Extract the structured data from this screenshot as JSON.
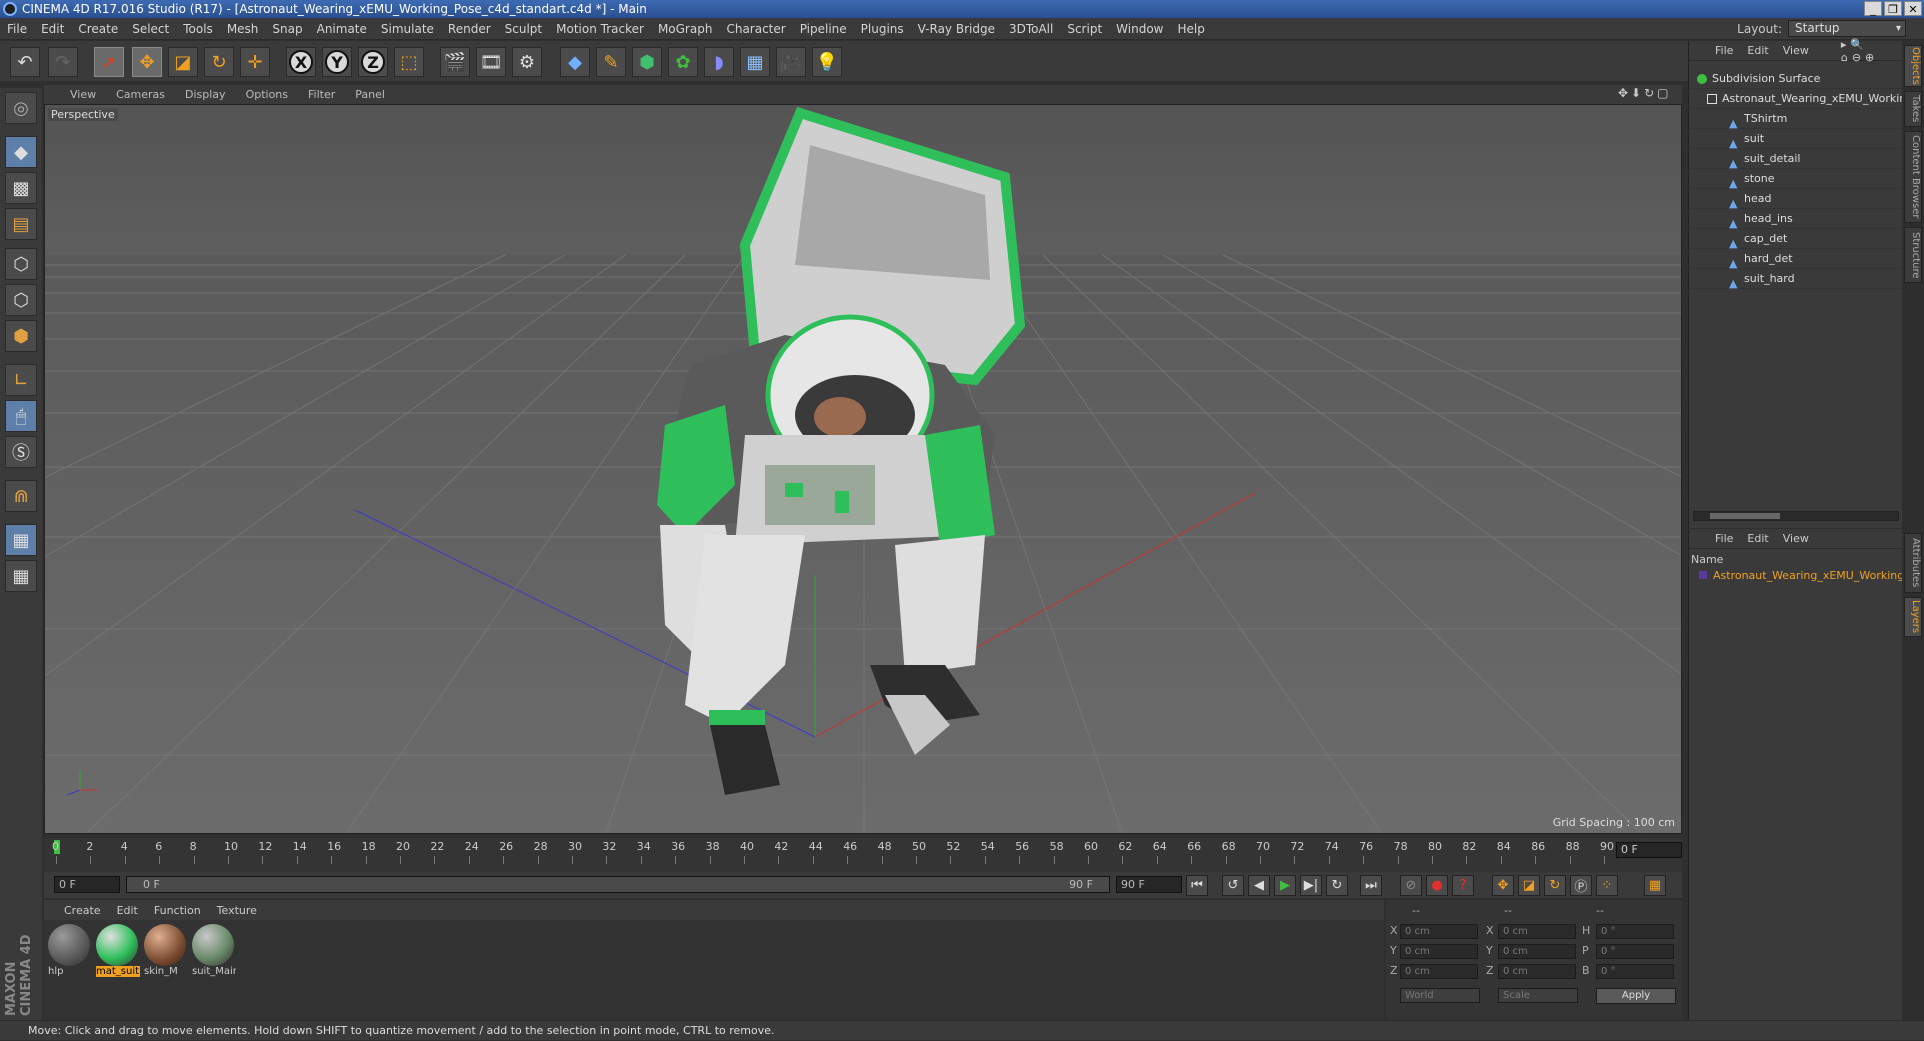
{
  "window": {
    "title": "CINEMA 4D R17.016 Studio (R17) - [Astronaut_Wearing_xEMU_Working_Pose_c4d_standart.c4d *] - Main"
  },
  "menu": [
    "File",
    "Edit",
    "Create",
    "Select",
    "Tools",
    "Mesh",
    "Snap",
    "Animate",
    "Simulate",
    "Render",
    "Sculpt",
    "Motion Tracker",
    "MoGraph",
    "Character",
    "Pipeline",
    "Plugins",
    "V-Ray Bridge",
    "3DToAll",
    "Script",
    "Window",
    "Help"
  ],
  "layout": {
    "label": "Layout:",
    "value": "Startup"
  },
  "viewport": {
    "menu": [
      "View",
      "Cameras",
      "Display",
      "Options",
      "Filter",
      "Panel"
    ],
    "camera": "Perspective",
    "grid_spacing": "Grid Spacing : 100 cm"
  },
  "timeline": {
    "ticks": [
      "0",
      "2",
      "4",
      "6",
      "8",
      "10",
      "12",
      "14",
      "16",
      "18",
      "20",
      "22",
      "24",
      "26",
      "28",
      "30",
      "32",
      "34",
      "36",
      "38",
      "40",
      "42",
      "44",
      "46",
      "48",
      "50",
      "52",
      "54",
      "56",
      "58",
      "60",
      "62",
      "64",
      "66",
      "68",
      "70",
      "72",
      "74",
      "76",
      "78",
      "80",
      "82",
      "84",
      "86",
      "88",
      "90"
    ],
    "current_frame": "0 F",
    "start": "0 F",
    "range_start": "0 F",
    "range_end": "90 F",
    "end": "90 F"
  },
  "materials": {
    "menu": [
      "Create",
      "Edit",
      "Function",
      "Texture"
    ],
    "items": [
      {
        "name": "hlp",
        "selected": false
      },
      {
        "name": "mat_suit",
        "selected": true
      },
      {
        "name": "skin_M",
        "selected": false
      },
      {
        "name": "suit_Mair",
        "selected": false
      }
    ]
  },
  "coords": {
    "header": [
      "--",
      "--",
      "--"
    ],
    "rows": [
      {
        "a": "X",
        "av": "0 cm",
        "b": "X",
        "bv": "0 cm",
        "c": "H",
        "cv": "0 °"
      },
      {
        "a": "Y",
        "av": "0 cm",
        "b": "Y",
        "bv": "0 cm",
        "c": "P",
        "cv": "0 °"
      },
      {
        "a": "Z",
        "av": "0 cm",
        "b": "Z",
        "bv": "0 cm",
        "c": "B",
        "cv": "0 °"
      }
    ],
    "mode": "World",
    "scale": "Scale",
    "apply": "Apply"
  },
  "status": "Move: Click and drag to move elements. Hold down SHIFT to quantize movement / add to the selection in point mode, CTRL to remove.",
  "objects": {
    "menu": [
      "File",
      "Edit",
      "View"
    ],
    "items": [
      {
        "name": "Subdivision Surface",
        "indent": 0,
        "color": "#3fbf3f"
      },
      {
        "name": "Astronaut_Wearing_xEMU_Workin",
        "indent": 1,
        "color": "#dddddd"
      },
      {
        "name": "TShirtm",
        "indent": 2,
        "color": "#6fa8e8"
      },
      {
        "name": "suit",
        "indent": 2,
        "color": "#6fa8e8"
      },
      {
        "name": "suit_detail",
        "indent": 2,
        "color": "#6fa8e8"
      },
      {
        "name": "stone",
        "indent": 2,
        "color": "#6fa8e8"
      },
      {
        "name": "head",
        "indent": 2,
        "color": "#6fa8e8"
      },
      {
        "name": "head_ins",
        "indent": 2,
        "color": "#6fa8e8"
      },
      {
        "name": "cap_det",
        "indent": 2,
        "color": "#6fa8e8"
      },
      {
        "name": "hard_det",
        "indent": 2,
        "color": "#6fa8e8"
      },
      {
        "name": "suit_hard",
        "indent": 2,
        "color": "#6fa8e8"
      }
    ]
  },
  "layers": {
    "menu": [
      "File",
      "Edit",
      "View"
    ],
    "column": "Name",
    "item": "Astronaut_Wearing_xEMU_Working"
  },
  "side_tabs": [
    "Objects",
    "Takes",
    "Content Browser",
    "Structure",
    "Attributes",
    "Layers"
  ],
  "logo": "MAXON CINEMA 4D"
}
